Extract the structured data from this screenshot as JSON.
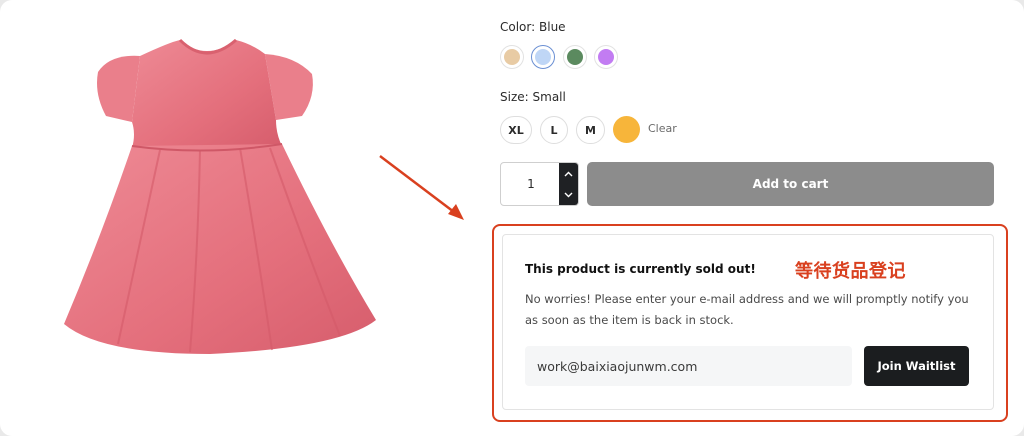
{
  "product": {
    "color_label": "Color:",
    "color_value": "Blue",
    "colors": [
      {
        "name": "beige",
        "hex": "#e8cba4",
        "selected": false
      },
      {
        "name": "blue",
        "hex": "#bfd6f6",
        "selected": true
      },
      {
        "name": "green",
        "hex": "#5b8a5f",
        "selected": false
      },
      {
        "name": "purple",
        "hex": "#c27cf2",
        "selected": false
      }
    ],
    "size_label": "Size:",
    "size_value": "Small",
    "sizes": [
      "XL",
      "L",
      "M"
    ],
    "selected_size_color": "#f7b53a",
    "clear_label": "Clear",
    "quantity": "1",
    "add_to_cart_label": "Add to cart"
  },
  "waitlist": {
    "title": "This product is currently sold out!",
    "annotation": "等待货品登记",
    "message": "No worries! Please enter your e-mail address and we will promptly notify you as soon as the item is back in stock.",
    "email_value": "work@baixiaojunwm.com",
    "button_label": "Join Waitlist"
  },
  "colors": {
    "accent_annotation": "#d9401f",
    "button_dark": "#1b1d1f",
    "disabled_button": "#8c8c8c",
    "dress": "#e66f7c"
  }
}
